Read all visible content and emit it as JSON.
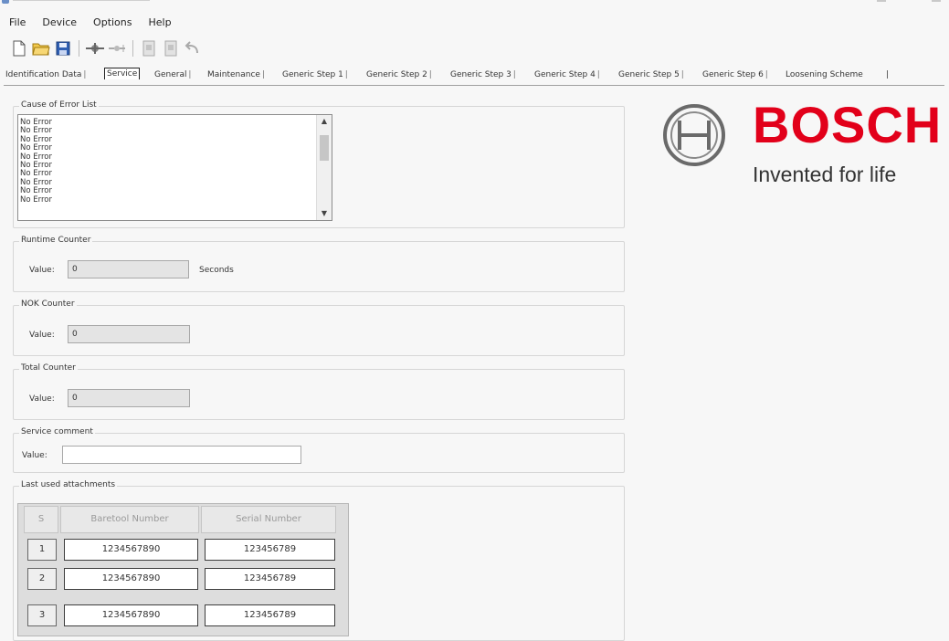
{
  "menu": [
    "File",
    "Device",
    "Options",
    "Help"
  ],
  "toolbar_icons": [
    "new-file-icon",
    "open-folder-icon",
    "save-icon",
    "connect-icon",
    "disconnect-icon",
    "upload-icon",
    "download-icon",
    "undo-icon"
  ],
  "tabs": [
    "Identification Data",
    "Service",
    "General",
    "Maintenance",
    "Generic Step 1",
    "Generic Step 2",
    "Generic Step 3",
    "Generic Step 4",
    "Generic Step 5",
    "Generic Step 6",
    "Loosening Scheme"
  ],
  "active_tab": "Service",
  "error_list": {
    "legend": "Cause of Error List",
    "items": [
      "No Error",
      "No Error",
      "No Error",
      "No Error",
      "No Error",
      "No Error",
      "No Error",
      "No Error",
      "No Error",
      "No Error"
    ]
  },
  "runtime": {
    "legend": "Runtime Counter",
    "value_label": "Value:",
    "value": "0",
    "unit": "Seconds"
  },
  "nok": {
    "legend": "NOK Counter",
    "value_label": "Value:",
    "value": "0"
  },
  "total": {
    "legend": "Total Counter",
    "value_label": "Value:",
    "value": "0"
  },
  "comment": {
    "legend": "Service comment",
    "value_label": "Value:",
    "value": ""
  },
  "attachments": {
    "legend": "Last used attachments",
    "columns": [
      "S",
      "Baretool Number",
      "Serial Number"
    ],
    "rows": [
      {
        "index": "1",
        "baretool": "1234567890",
        "serial": "123456789"
      },
      {
        "index": "2",
        "baretool": "1234567890",
        "serial": "123456789"
      },
      {
        "index": "3",
        "baretool": "1234567890",
        "serial": "123456789"
      }
    ]
  },
  "logo": {
    "brand": "BOSCH",
    "tagline": "Invented for life",
    "brand_color": "#e2001a"
  }
}
